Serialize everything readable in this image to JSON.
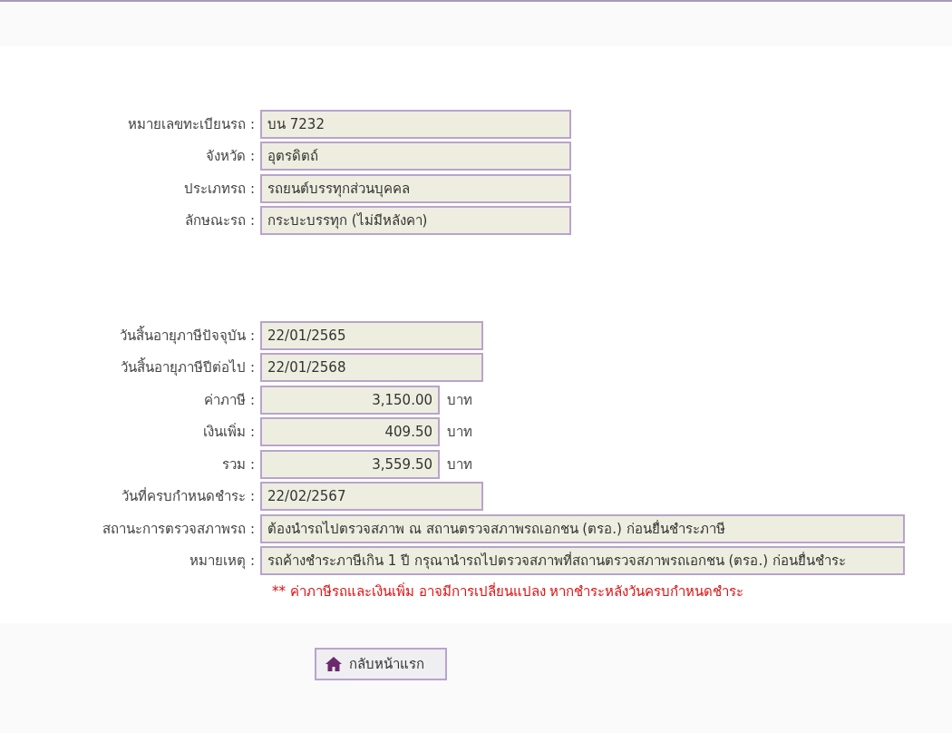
{
  "sections": [
    {
      "rows": [
        {
          "label": "หมายเลขทะเบียนรถ :",
          "value": "บน 7232",
          "kind": "text"
        },
        {
          "label": "จังหวัด :",
          "value": "อุตรดิตถ์",
          "kind": "text"
        },
        {
          "label": "ประเภทรถ :",
          "value": "รถยนต์บรรทุกส่วนบุคคล",
          "kind": "text"
        },
        {
          "label": "ลักษณะรถ :",
          "value": "กระบะบรรทุก (ไม่มีหลังคา)",
          "kind": "text"
        }
      ]
    },
    {
      "rows": [
        {
          "label": "วันสิ้นอายุภาษีปัจจุบัน :",
          "value": "22/01/2565",
          "kind": "date"
        },
        {
          "label": "วันสิ้นอายุภาษีปีต่อไป :",
          "value": "22/01/2568",
          "kind": "date"
        },
        {
          "label": "ค่าภาษี :",
          "value": "3,150.00",
          "kind": "money",
          "unit": "บาท"
        },
        {
          "label": "เงินเพิ่ม :",
          "value": "409.50",
          "kind": "money",
          "unit": "บาท"
        },
        {
          "label": "รวม :",
          "value": "3,559.50",
          "kind": "money",
          "unit": "บาท"
        },
        {
          "label": "วันที่ครบกำหนดชำระ :",
          "value": "22/02/2567",
          "kind": "date"
        },
        {
          "label": "สถานะการตรวจสภาพรถ :",
          "value": "ต้องนำรถไปตรวจสภาพ ณ สถานตรวจสภาพรถเอกชน (ตรอ.) ก่อนยื่นชำระภาษี",
          "kind": "long"
        },
        {
          "label": "หมายเหตุ :",
          "value": "รถค้างชำระภาษีเกิน 1 ปี กรุณานำรถไปตรวจสภาพที่สถานตรวจสภาพรถเอกชน (ตรอ.) ก่อนยื่นชำระ",
          "kind": "long"
        }
      ]
    }
  ],
  "note": "** ค่าภาษีรถและเงินเพิ่ม อาจมีการเปลี่ยนแปลง หากชำระหลังวันครบกำหนดชำระ",
  "home_button": {
    "label": "กลับหน้าแรก"
  }
}
